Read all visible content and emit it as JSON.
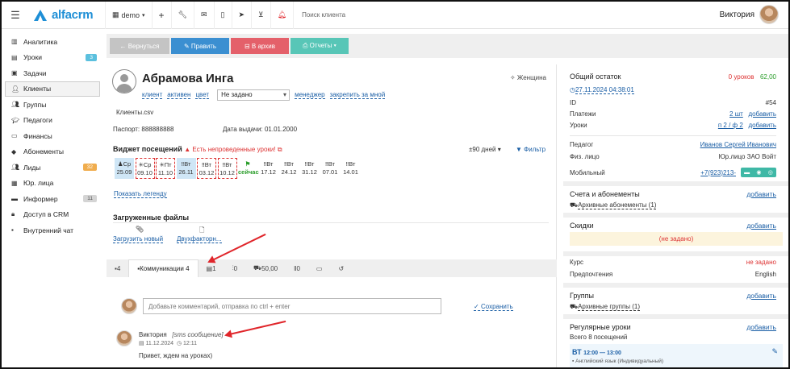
{
  "topbar": {
    "logo_text": "alfacrm",
    "branch": "demo",
    "search_placeholder": "Поиск клиента",
    "user_name": "Виктория"
  },
  "sidebar": {
    "items": [
      {
        "label": "Аналитика",
        "icon": "chart-icon"
      },
      {
        "label": "Уроки",
        "icon": "calendar-icon",
        "badge": "3",
        "badge_color": "#5bc0de"
      },
      {
        "label": "Задачи",
        "icon": "task-icon"
      },
      {
        "label": "Клиенты",
        "icon": "user-icon"
      },
      {
        "label": "Группы",
        "icon": "users-icon"
      },
      {
        "label": "Педагоги",
        "icon": "teacher-icon"
      },
      {
        "label": "Финансы",
        "icon": "money-icon"
      },
      {
        "label": "Абонементы",
        "icon": "tag-icon"
      },
      {
        "label": "Лиды",
        "icon": "leads-icon",
        "badge": "32",
        "badge_color": "#f0ad4e"
      },
      {
        "label": "Юр. лица",
        "icon": "building-icon"
      },
      {
        "label": "Информер",
        "icon": "informer-icon",
        "badge": "11",
        "badge_color": "#c8c8c8"
      },
      {
        "label": "Доступ в CRM",
        "icon": "lock-icon"
      },
      {
        "label": "Внутренний чат",
        "icon": "chat-icon"
      }
    ]
  },
  "actions": {
    "back": "← Вернуться",
    "edit": "✎ Править",
    "archive": "⊟ В архив",
    "reports": "⎙ Отчеты ▾"
  },
  "client": {
    "name": "Абрамова Инга",
    "gender": "Женщина",
    "tags": [
      "клиент",
      "активен",
      "цвет"
    ],
    "status_select": "Не задано",
    "manager_link": "менеджер",
    "assign_link": "закрепить за мной",
    "file_name": "Клиенты.csv",
    "passport_label": "Паспорт:",
    "passport_value": "888888888",
    "issue_label": "Дата выдачи:",
    "issue_value": "01.01.2000"
  },
  "attendance": {
    "title": "Виджет посещений",
    "warning": "Есть непроведенные уроки!",
    "period": "±90 дней",
    "filter": "Фильтр",
    "legend_link": "Показать легенду",
    "days": [
      {
        "wd": "Ср",
        "date": "25.09",
        "style": "blue",
        "mark": "✓"
      },
      {
        "wd": "Ср",
        "date": "09.10",
        "style": "red",
        "mark": ""
      },
      {
        "wd": "Пт",
        "date": "11.10",
        "style": "red",
        "mark": ""
      },
      {
        "wd": "Вт",
        "date": "26.11",
        "style": "blue",
        "mark": "✓"
      },
      {
        "wd": "Вт",
        "date": "03.12",
        "style": "red",
        "mark": ""
      },
      {
        "wd": "Вт",
        "date": "10.12",
        "style": "red",
        "mark": ""
      },
      {
        "wd": "",
        "date": "сейчас",
        "style": "now",
        "mark": "⚑"
      },
      {
        "wd": "Вт",
        "date": "17.12",
        "style": "",
        "mark": ""
      },
      {
        "wd": "Вт",
        "date": "24.12",
        "style": "",
        "mark": ""
      },
      {
        "wd": "Вт",
        "date": "31.12",
        "style": "",
        "mark": ""
      },
      {
        "wd": "Вт",
        "date": "07.01",
        "style": "",
        "mark": ""
      },
      {
        "wd": "Вт",
        "date": "14.01",
        "style": "",
        "mark": ""
      }
    ]
  },
  "files": {
    "title": "Загруженные файлы",
    "upload": "Загрузить новый",
    "file": "Двухфакторн..."
  },
  "tabs": [
    {
      "label": "4",
      "icon": "comment-icon"
    },
    {
      "label": "Коммуникации 4",
      "icon": "chat-icon",
      "active": true
    },
    {
      "label": "1",
      "icon": "doc-icon"
    },
    {
      "label": "0",
      "icon": "chart-icon"
    },
    {
      "label": "50,00",
      "icon": "bonus-icon"
    },
    {
      "label": "0",
      "icon": "pause-icon"
    },
    {
      "label": "",
      "icon": "money-icon"
    },
    {
      "label": "",
      "icon": "history-icon"
    }
  ],
  "comment": {
    "placeholder": "Добавьте комментарий, отправка по ctrl + enter",
    "save": "Сохранить",
    "author": "Виктория",
    "type": "[sms сообщение]",
    "date": "11.12.2024",
    "time": "12:11",
    "text": "Привет, ждем на уроках)"
  },
  "balance": {
    "title": "Общий остаток",
    "lessons": "0 уроков",
    "amount": "62,00",
    "date_link": "27.11.2024 04:38:01",
    "id_label": "ID",
    "id_value": "#54",
    "payments_label": "Платежи",
    "payments_value": "2 шт",
    "lessons_label": "Уроки",
    "lessons_value": "п 2 / ф 2",
    "add": "добавить",
    "teacher_label": "Педагог",
    "teacher_value": "Иванов Сергей Иванович",
    "person_label": "Физ. лицо",
    "person_value": "Юр.лицо ЗАО Войт",
    "mobile_label": "Мобильный",
    "mobile_value": "+7(923)213-"
  },
  "subscriptions": {
    "title": "Счета и абонементы",
    "archive": "Архивные абонементы (1)"
  },
  "discounts": {
    "title": "Скидки",
    "empty": "(не задано)"
  },
  "course": {
    "label": "Курс",
    "value": "не задано",
    "pref_label": "Предпочтения",
    "pref_value": "English"
  },
  "groups": {
    "title": "Группы",
    "archive": "Архивные группы (1)"
  },
  "regular": {
    "title": "Регулярные уроки",
    "subtitle": "Всего 8 посещений",
    "day": "ВТ",
    "time": "12:00 — 13:00",
    "subject": "Английский язык (Индивидуальный)"
  }
}
